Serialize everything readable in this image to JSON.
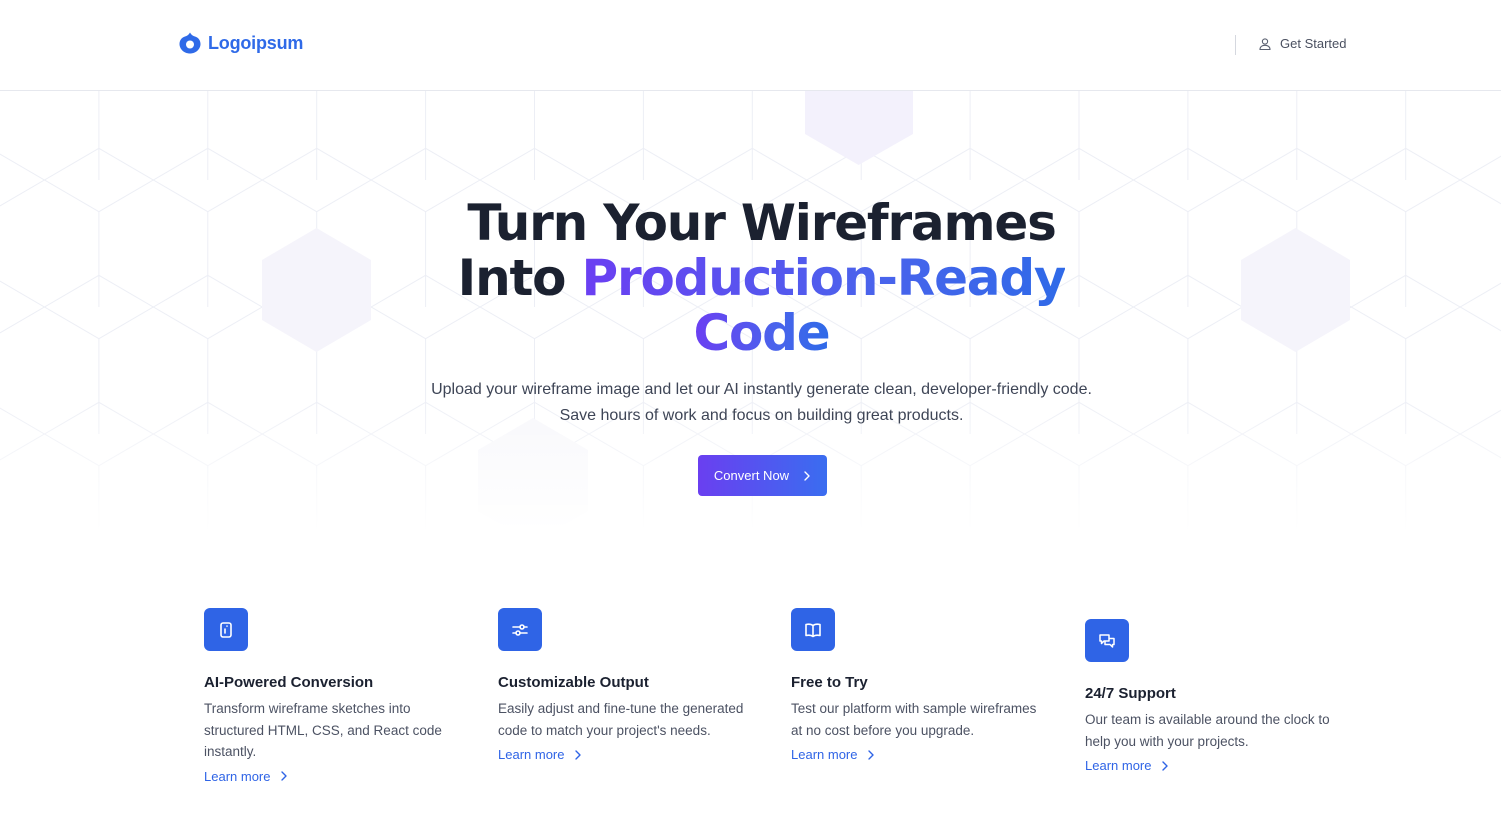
{
  "brand": {
    "name": "Logoipsum",
    "accent_color": "#2f6ae8"
  },
  "header": {
    "get_started_label": "Get Started",
    "get_started_icon": "user-icon"
  },
  "hero": {
    "headline_line1": "Turn Your Wireframes",
    "headline_line2_plain": "Into",
    "headline_line2_accent": "Production-Ready",
    "headline_line3_accent": "Code",
    "subtext_line1": "Upload your wireframe image and let our AI instantly generate clean, developer-friendly code.",
    "subtext_line2": "Save hours of work and focus on building great products.",
    "cta_label": "Convert Now",
    "cta_gradient": [
      "#6a3ff0",
      "#3a6df0"
    ]
  },
  "features": [
    {
      "icon": "mobile-icon",
      "title": "AI-Powered Conversion",
      "description": "Transform wireframe sketches into structured HTML, CSS, and React code instantly.",
      "link": "Learn more"
    },
    {
      "icon": "sliders-icon",
      "title": "Customizable Output",
      "description": "Easily adjust and fine-tune the generated code to match your project's needs.",
      "link": "Learn more"
    },
    {
      "icon": "book-icon",
      "title": "Free to Try",
      "description": "Test our platform with sample wireframes at no cost before you upgrade.",
      "link": "Learn more"
    },
    {
      "icon": "chat-icon",
      "title": "24/7 Support",
      "description": "Our team is available around the clock to help you with your projects.",
      "link": "Learn more"
    }
  ],
  "feature_icon_color": "#2f64e6"
}
